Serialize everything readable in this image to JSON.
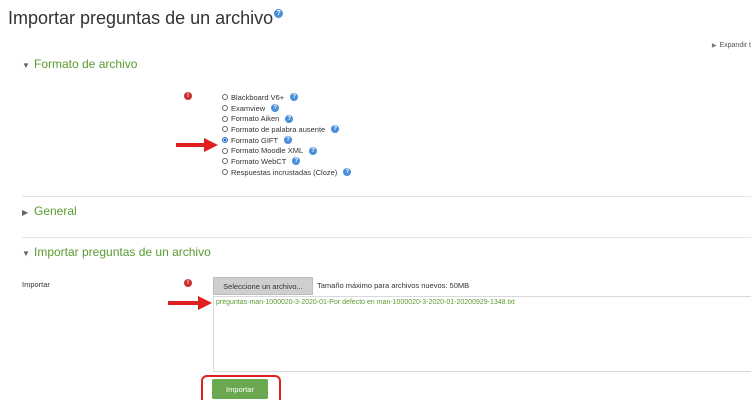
{
  "page": {
    "title": "Importar preguntas de un archivo",
    "expand_all": "Expandir t"
  },
  "sections": {
    "format": "Formato de archivo",
    "general": "General",
    "import": "Importar preguntas de un archivo"
  },
  "format_options": [
    {
      "label": "Blackboard V6+",
      "checked": false
    },
    {
      "label": "Examview",
      "checked": false
    },
    {
      "label": "Formato Aiken",
      "checked": false
    },
    {
      "label": "Formato de palabra ausente",
      "checked": false
    },
    {
      "label": "Formato GIFT",
      "checked": true
    },
    {
      "label": "Formato Moodle XML",
      "checked": false
    },
    {
      "label": "Formato WebCT",
      "checked": false
    },
    {
      "label": "Respuestas incrustadas (Cloze)",
      "checked": false
    }
  ],
  "import_field": {
    "label": "Importar",
    "choose_button": "Seleccione un archivo...",
    "max_size": "Tamaño máximo para archivos nuevos: 50MB",
    "file_name": "preguntas-man-1000020-3-2020-01-Por defecto en man-1000020-3-2020-01-20200929-1348.txt"
  },
  "submit_label": "Importar",
  "colors": {
    "section_green": "#5a9a30",
    "button_green": "#6aa84f",
    "annotation_red": "#e02020",
    "help_blue": "#4a90d9",
    "required_red": "#c9302c"
  }
}
